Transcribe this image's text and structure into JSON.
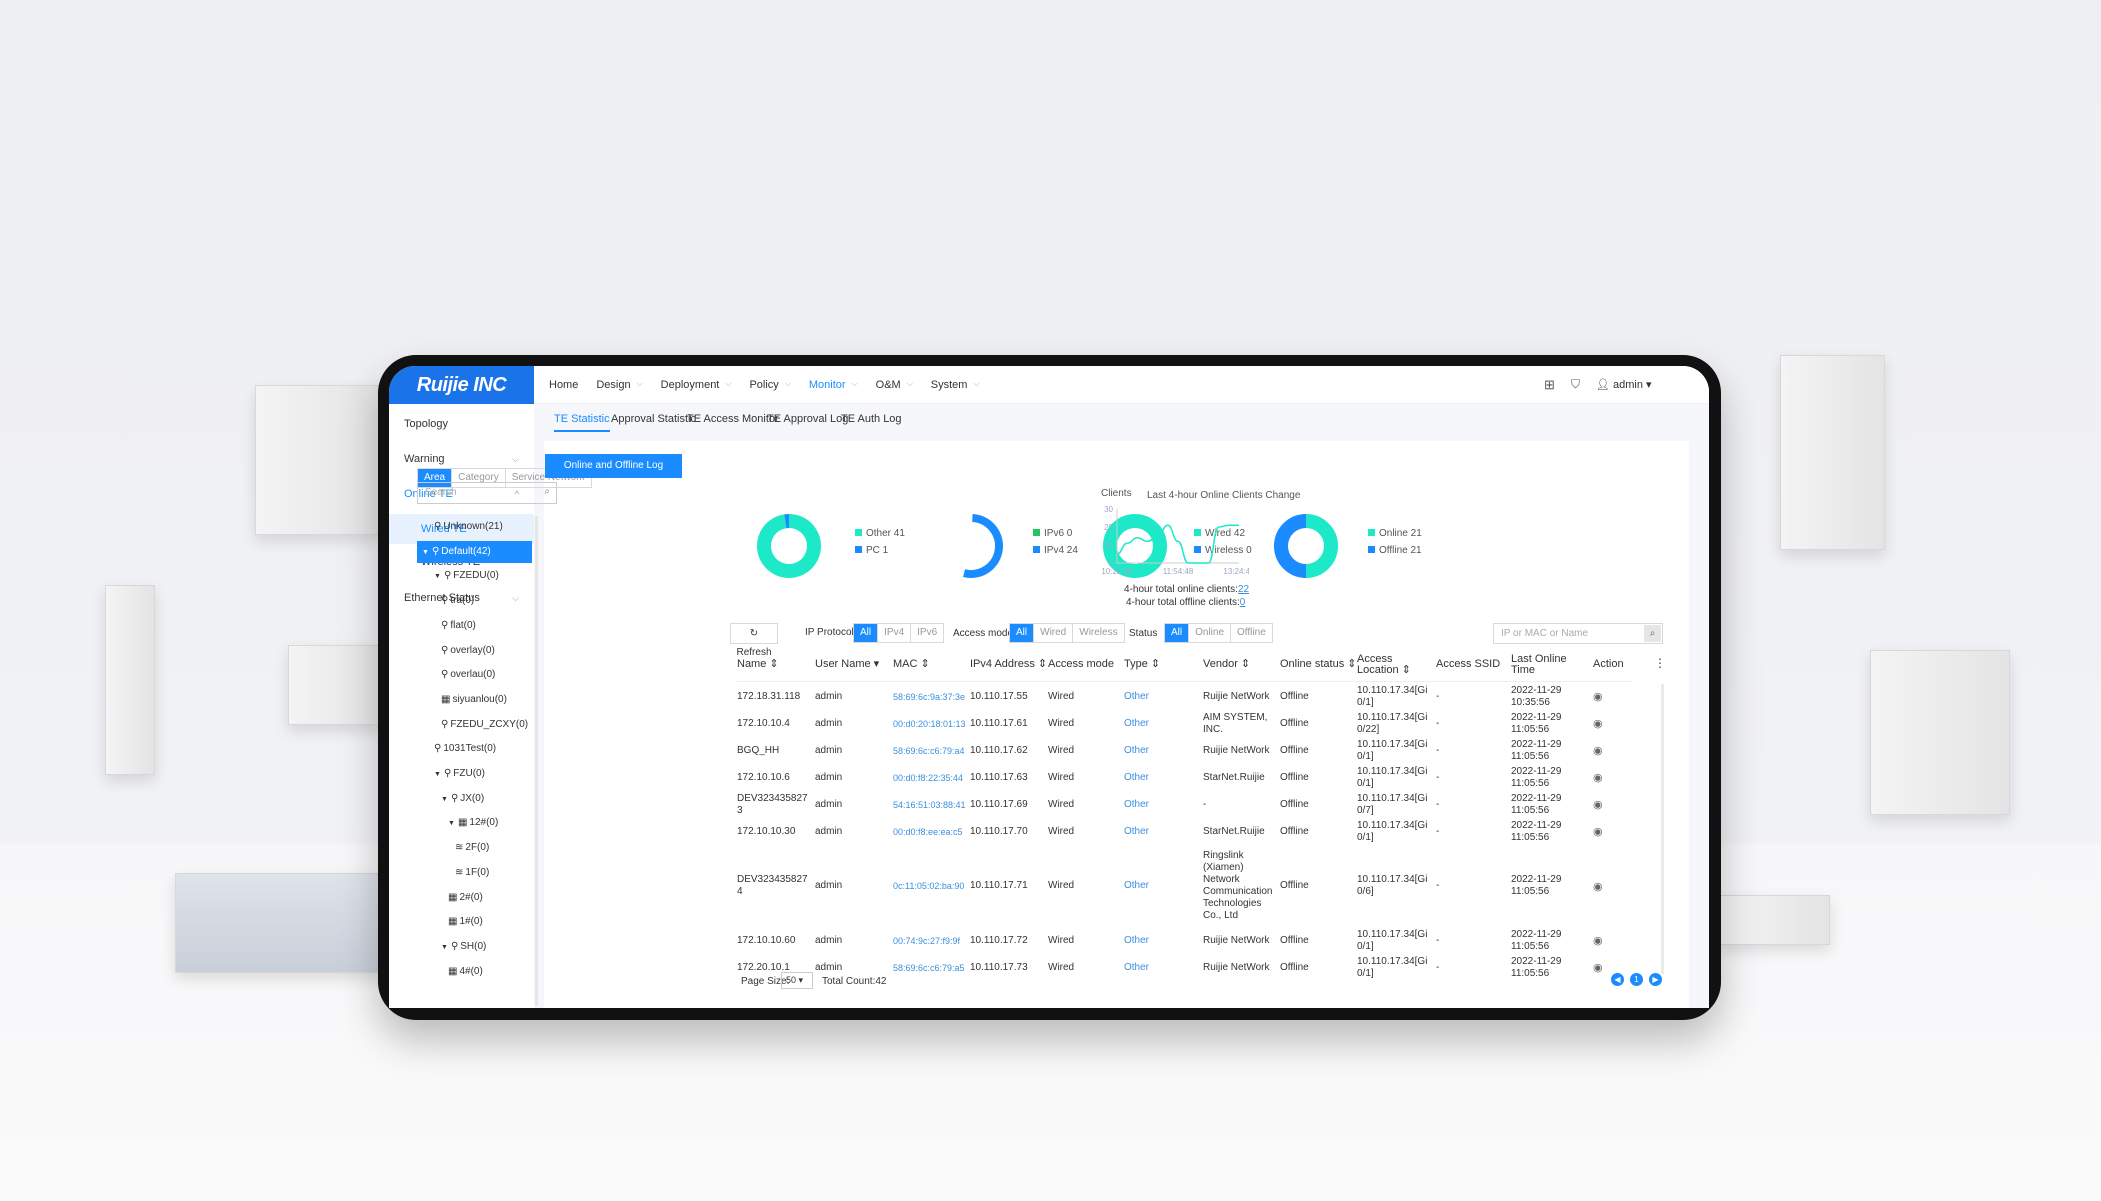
{
  "brand": {
    "logo": "Ruijie INC",
    "primary": "#1a73e8",
    "accent": "#1a8cff",
    "teal": "#1de9c9"
  },
  "topnav": {
    "items": [
      "Home",
      "Design",
      "Deployment",
      "Policy",
      "Monitor",
      "O&M",
      "System"
    ],
    "active": "Monitor",
    "user": "admin"
  },
  "sidebar": {
    "items": [
      {
        "label": "Topology"
      },
      {
        "label": "Warning",
        "chevron": "down"
      },
      {
        "label": "Online TE",
        "chevron": "up",
        "active": true
      },
      {
        "label": "Wired TE",
        "sub": true,
        "selected": true
      },
      {
        "label": "Wireless TE",
        "sub": true
      },
      {
        "label": "Ethernet Status",
        "chevron": "down"
      }
    ]
  },
  "tabs": [
    "TE Statistic",
    "Approval Statistic",
    "TE Access Monitor",
    "TE Approval Log",
    "TE Auth Log"
  ],
  "tree_panel": {
    "tabs": [
      "Area",
      "Category",
      "Service Network"
    ],
    "search_placeholder": "Search",
    "items": [
      {
        "label": "Unknown(21)",
        "d": 1,
        "icon": "location"
      },
      {
        "label": "Default(42)",
        "d": 0,
        "icon": "location",
        "caret": true,
        "selected": true
      },
      {
        "label": "FZEDU(0)",
        "d": 1,
        "icon": "location",
        "caret": true
      },
      {
        "label": "tra(0)",
        "d": 2,
        "icon": "location"
      },
      {
        "label": "flat(0)",
        "d": 2,
        "icon": "location"
      },
      {
        "label": "overlay(0)",
        "d": 2,
        "icon": "location"
      },
      {
        "label": "overlau(0)",
        "d": 2,
        "icon": "location"
      },
      {
        "label": "siyuanlou(0)",
        "d": 2,
        "icon": "building"
      },
      {
        "label": "FZEDU_ZCXY(0)",
        "d": 2,
        "icon": "location"
      },
      {
        "label": "1031Test(0)",
        "d": 1,
        "icon": "location"
      },
      {
        "label": "FZU(0)",
        "d": 1,
        "icon": "location",
        "caret": true
      },
      {
        "label": "JX(0)",
        "d": 2,
        "icon": "location",
        "caret": true
      },
      {
        "label": "12#(0)",
        "d": 3,
        "icon": "building",
        "caret": true
      },
      {
        "label": "2F(0)",
        "d": 4,
        "icon": "floor"
      },
      {
        "label": "1F(0)",
        "d": 4,
        "icon": "floor"
      },
      {
        "label": "2#(0)",
        "d": 3,
        "icon": "building"
      },
      {
        "label": "1#(0)",
        "d": 3,
        "icon": "building"
      },
      {
        "label": "SH(0)",
        "d": 2,
        "icon": "location",
        "caret": true
      },
      {
        "label": "4#(0)",
        "d": 3,
        "icon": "building"
      }
    ]
  },
  "log_button": "Online and Offline Log",
  "donuts": [
    {
      "legend": [
        {
          "label": "Other 41",
          "value": 41,
          "color": "#1de9c9"
        },
        {
          "label": "PC 1",
          "value": 1,
          "color": "#1a8cff"
        }
      ]
    },
    {
      "legend": [
        {
          "label": "IPv6 0",
          "value": 0,
          "color": "#22c55e"
        },
        {
          "label": "IPv4 24",
          "value": 24,
          "color": "#1a8cff"
        }
      ],
      "arc_only": true
    },
    {
      "legend": [
        {
          "label": "Wired 42",
          "value": 42,
          "color": "#1de9c9"
        },
        {
          "label": "Wireless 0",
          "value": 0,
          "color": "#1a8cff"
        }
      ]
    },
    {
      "legend": [
        {
          "label": "Online 21",
          "value": 21,
          "color": "#1de9c9"
        },
        {
          "label": "Offline 21",
          "value": 21,
          "color": "#1a8cff"
        }
      ]
    }
  ],
  "chart_data": {
    "type": "line",
    "title": "Last 4-hour Online Clients Change",
    "ylabel": "Clients",
    "ylim": [
      0,
      30
    ],
    "yticks": [
      "30",
      "20",
      "10",
      "0"
    ],
    "xticks": [
      "10:21:59",
      "11:54:48",
      "13:24:48"
    ],
    "values": [
      5,
      11,
      14,
      12,
      15,
      21,
      12,
      0,
      0,
      0,
      20,
      21,
      21
    ],
    "color": "#1de9c9"
  },
  "totals": {
    "online_label": "4-hour total online clients:",
    "online": "22",
    "offline_label": "4-hour total offline clients:",
    "offline": "0"
  },
  "filters": {
    "refresh": "Refresh",
    "ip_label": "IP Protocol",
    "ip": [
      "All",
      "IPv4",
      "IPv6"
    ],
    "access_label": "Access mode",
    "access": [
      "All",
      "Wired",
      "Wireless"
    ],
    "status_label": "Status",
    "status": [
      "All",
      "Online",
      "Offline"
    ],
    "search_placeholder": "IP or MAC or Name"
  },
  "table": {
    "columns": [
      "Name ⇕",
      "User Name ▾",
      "MAC ⇕",
      "IPv4 Address ⇕",
      "Access mode",
      "Type ⇕",
      "Vendor ⇕",
      "Online status ⇕",
      "Access Location ⇕",
      "Access SSID",
      "Last Online Time",
      "Action"
    ],
    "rows": [
      [
        "172.18.31.118",
        "admin",
        "58:69:6c:9a:37:3e",
        "10.110.17.55",
        "Wired",
        "Other",
        "Ruijie NetWork",
        "Offline",
        "10.110.17.34[Gi0/1]",
        "-",
        "2022-11-29 10:35:56"
      ],
      [
        "172.10.10.4",
        "admin",
        "00:d0:20:18:01:13",
        "10.110.17.61",
        "Wired",
        "Other",
        "AIM SYSTEM, INC.",
        "Offline",
        "10.110.17.34[Gi0/22]",
        "-",
        "2022-11-29 11:05:56"
      ],
      [
        "BGQ_HH",
        "admin",
        "58:69:6c:c6:79:a4",
        "10.110.17.62",
        "Wired",
        "Other",
        "Ruijie NetWork",
        "Offline",
        "10.110.17.34[Gi0/1]",
        "-",
        "2022-11-29 11:05:56"
      ],
      [
        "172.10.10.6",
        "admin",
        "00:d0:f8:22:35:44",
        "10.110.17.63",
        "Wired",
        "Other",
        "StarNet.Ruijie",
        "Offline",
        "10.110.17.34[Gi0/1]",
        "-",
        "2022-11-29 11:05:56"
      ],
      [
        "DEV3234358273",
        "admin",
        "54:16:51:03:88:41",
        "10.110.17.69",
        "Wired",
        "Other",
        "-",
        "Offline",
        "10.110.17.34[Gi0/7]",
        "-",
        "2022-11-29 11:05:56"
      ],
      [
        "172.10.10.30",
        "admin",
        "00:d0:f8:ee:ea:c5",
        "10.110.17.70",
        "Wired",
        "Other",
        "StarNet.Ruijie",
        "Offline",
        "10.110.17.34[Gi0/1]",
        "-",
        "2022-11-29 11:05:56"
      ],
      [
        "DEV3234358274",
        "admin",
        "0c:11:05:02:ba:90",
        "10.110.17.71",
        "Wired",
        "Other",
        "Ringslink (Xiamen) Network Communication Technologies Co., Ltd",
        "Offline",
        "10.110.17.34[Gi0/6]",
        "-",
        "2022-11-29 11:05:56"
      ],
      [
        "172.10.10.60",
        "admin",
        "00:74:9c:27:f9:9f",
        "10.110.17.72",
        "Wired",
        "Other",
        "Ruijie NetWork",
        "Offline",
        "10.110.17.34[Gi0/1]",
        "-",
        "2022-11-29 11:05:56"
      ],
      [
        "172.20.10.1",
        "admin",
        "58:69:6c:c6:79:a5",
        "10.110.17.73",
        "Wired",
        "Other",
        "Ruijie NetWork",
        "Offline",
        "10.110.17.34[Gi0/1]",
        "-",
        "2022-11-29 11:05:56"
      ]
    ]
  },
  "pagination": {
    "page_size_label": "Page Size:",
    "page_size": "50",
    "total": "Total Count:42",
    "current": "1"
  }
}
